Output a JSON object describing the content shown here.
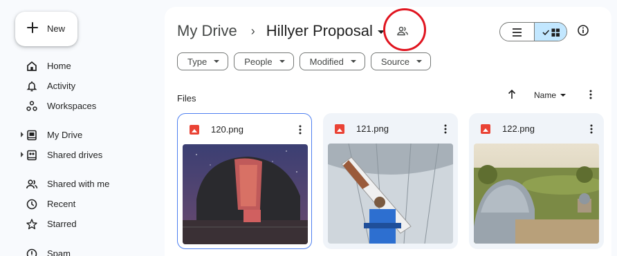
{
  "sidebar": {
    "new_label": "New",
    "items": [
      {
        "label": "Home",
        "icon": "home-icon"
      },
      {
        "label": "Activity",
        "icon": "bell-icon"
      },
      {
        "label": "Workspaces",
        "icon": "workspaces-icon"
      },
      {
        "label": "My Drive",
        "icon": "drive-icon"
      },
      {
        "label": "Shared drives",
        "icon": "shared-drives-icon"
      },
      {
        "label": "Shared with me",
        "icon": "people-icon"
      },
      {
        "label": "Recent",
        "icon": "clock-icon"
      },
      {
        "label": "Starred",
        "icon": "star-icon"
      },
      {
        "label": "Spam",
        "icon": "spam-icon"
      }
    ]
  },
  "header": {
    "breadcrumb_root": "My Drive",
    "breadcrumb_separator": "›",
    "breadcrumb_current": "Hillyer Proposal"
  },
  "filters": [
    "Type",
    "People",
    "Modified",
    "Source"
  ],
  "files_section": {
    "label": "Files",
    "sort_label": "Name"
  },
  "files": [
    {
      "name": "120.png"
    },
    {
      "name": "121.png"
    },
    {
      "name": "122.png"
    }
  ],
  "colors": {
    "accent": "#c2e7ff",
    "highlight_circle": "#e0141f",
    "selected_border": "#4d7ff0",
    "image_icon": "#ea4335"
  }
}
